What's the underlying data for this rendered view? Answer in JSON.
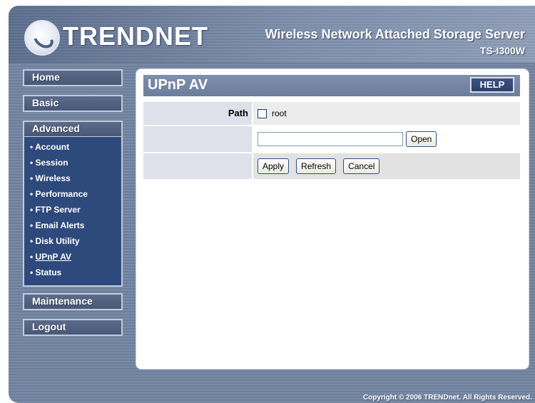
{
  "header": {
    "logo_text": "TRENDNET",
    "product_title": "Wireless Network Attached Storage Server",
    "product_model": "TS-I300W"
  },
  "nav": {
    "home": "Home",
    "basic": "Basic",
    "advanced": "Advanced",
    "advanced_items": [
      "Account",
      "Session",
      "Wireless",
      "Performance",
      "FTP Server",
      "Email Alerts",
      "Disk Utility",
      "UPnP AV",
      "Status"
    ],
    "active_item": "UPnP AV",
    "maintenance": "Maintenance",
    "logout": "Logout"
  },
  "content": {
    "title": "UPnP AV",
    "help_label": "HELP",
    "path_label": "Path",
    "root_checkbox_label": "root",
    "root_checked": false,
    "path_input_value": "",
    "open_label": "Open",
    "apply_label": "Apply",
    "refresh_label": "Refresh",
    "cancel_label": "Cancel"
  },
  "footer": {
    "copyright": "Copyright © 2006 TRENDnet. All Rights Reserved."
  },
  "colors": {
    "frame_bg": "#6d7e9b",
    "nav_button": "#485878",
    "nav_submenu": "#2e4a7c",
    "title_bar": "#6c7d9c",
    "help_button": "#2c3f6c"
  }
}
